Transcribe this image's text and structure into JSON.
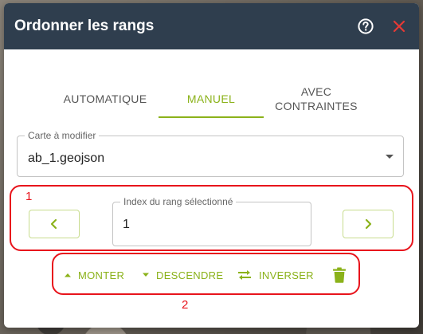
{
  "dialog": {
    "title": "Ordonner les rangs",
    "help_icon": "help-circle-icon",
    "close_icon": "close-x-icon"
  },
  "tabs": [
    {
      "label": "AUTOMATIQUE",
      "active": false
    },
    {
      "label": "MANUEL",
      "active": true
    },
    {
      "label": "AVEC\nCONTRAINTES",
      "active": false
    }
  ],
  "map_select": {
    "label": "Carte à modifier",
    "value": "ab_1.geojson"
  },
  "rank_index": {
    "label": "Index du rang sélectionné",
    "value": "1"
  },
  "nav": {
    "prev_icon": "chevron-left-icon",
    "next_icon": "chevron-right-icon"
  },
  "actions": {
    "up_label": "MONTER",
    "down_label": "DESCENDRE",
    "reverse_label": "INVERSER",
    "delete_icon": "trash-icon"
  },
  "annotations": {
    "first_number": "1",
    "second_number": "2"
  },
  "colors": {
    "accent": "#8bb21a",
    "titlebar": "#2f3e4e",
    "annotation": "#e8141c",
    "close": "#e53935"
  }
}
